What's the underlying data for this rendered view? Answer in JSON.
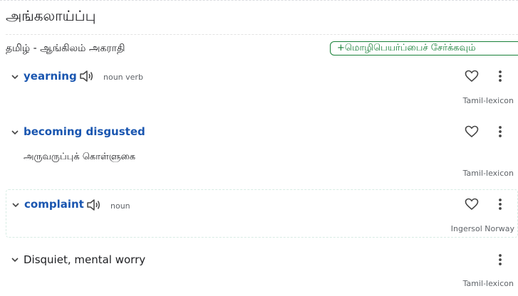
{
  "header": {
    "headword": "அங்கலாய்ப்பு"
  },
  "dictionary": {
    "title": "தமிழ் - ஆங்கிலம் அகராதி",
    "add_translation_label": "+மொழிபெயர்ப்பைச் சேர்க்கவும்"
  },
  "entries": [
    {
      "term": "yearning",
      "pos": "noun verb",
      "definition": "",
      "source": "Tamil-lexicon"
    },
    {
      "term": "becoming disgusted",
      "pos": "",
      "definition": "அருவருப்புக் கொள்ளுகை",
      "source": "Tamil-lexicon"
    },
    {
      "term": "complaint",
      "pos": "noun",
      "definition": "",
      "source": "Ingersol Norway"
    },
    {
      "term": "Disquiet, mental worry",
      "pos": "",
      "definition": "",
      "source": "Tamil-lexicon"
    }
  ],
  "icons": {
    "expand": "chevron-down-icon",
    "pronounce": "speaker-icon",
    "favorite": "heart-outline-icon",
    "menu": "more-vert-icon"
  },
  "colors": {
    "term_link": "#1a56b0",
    "add_button": "#188038",
    "muted": "#5f6368"
  }
}
